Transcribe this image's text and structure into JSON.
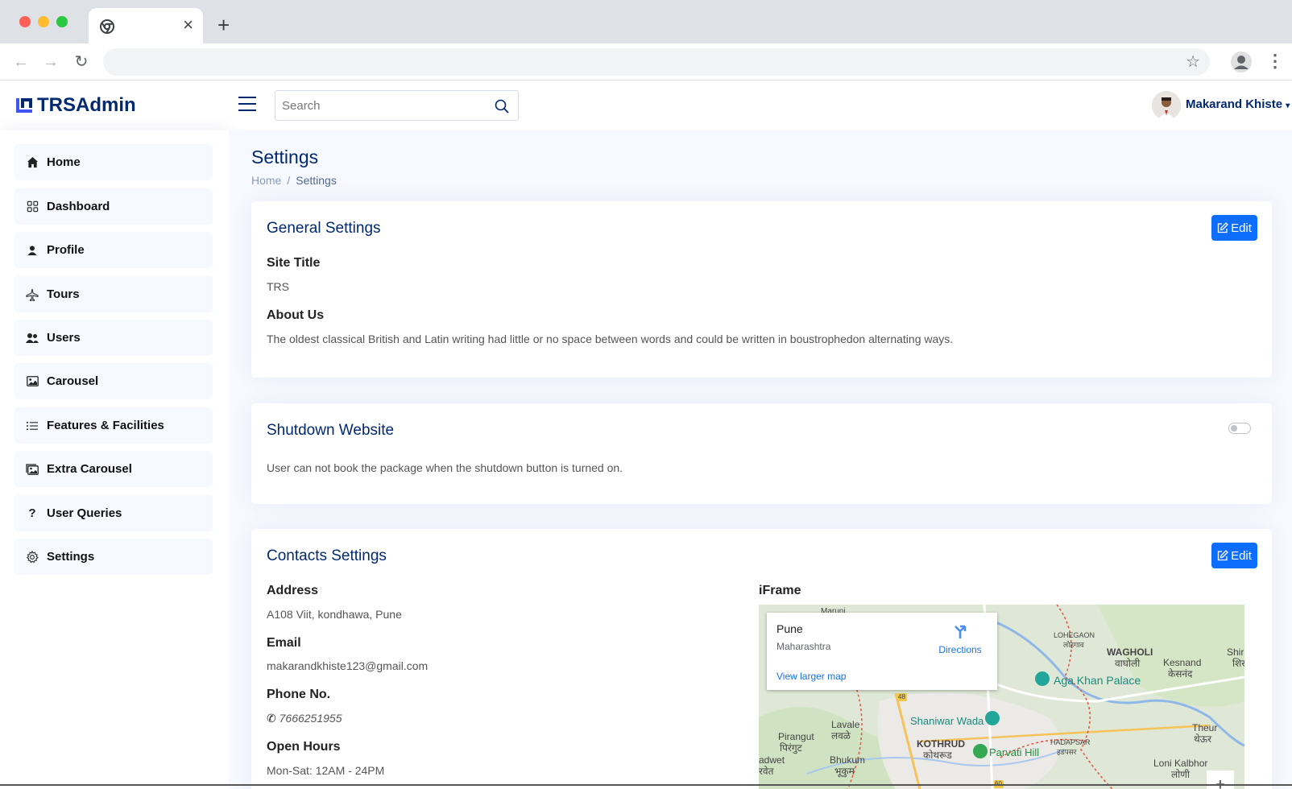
{
  "browser": {
    "colors": {
      "close": "#ff5f57",
      "minimize": "#febc2e",
      "maximize": "#28c840"
    }
  },
  "header": {
    "logo_text": "TRSAdmin",
    "search_placeholder": "Search",
    "user_name": "Makarand Khiste"
  },
  "sidebar": {
    "items": [
      {
        "label": "Home",
        "icon": "house-icon"
      },
      {
        "label": "Dashboard",
        "icon": "grid-icon"
      },
      {
        "label": "Profile",
        "icon": "person-icon"
      },
      {
        "label": "Tours",
        "icon": "airplane-icon"
      },
      {
        "label": "Users",
        "icon": "people-icon"
      },
      {
        "label": "Carousel",
        "icon": "image-icon"
      },
      {
        "label": "Features & Facilities",
        "icon": "list-icon"
      },
      {
        "label": "Extra Carousel",
        "icon": "images-icon"
      },
      {
        "label": "User Queries",
        "icon": "question-icon"
      },
      {
        "label": "Settings",
        "icon": "gear-icon"
      }
    ]
  },
  "page": {
    "title": "Settings",
    "breadcrumb": [
      "Home",
      "Settings"
    ]
  },
  "general": {
    "title": "General Settings",
    "edit_label": "Edit",
    "site_title_label": "Site Title",
    "site_title_value": "TRS",
    "about_label": "About Us",
    "about_value": "The oldest classical British and Latin writing had little or no space between words and could be written in boustrophedon alternating ways."
  },
  "shutdown": {
    "title": "Shutdown Website",
    "description": "User can not book the package when the shutdown button is turned on.",
    "enabled": false
  },
  "contacts": {
    "title": "Contacts Settings",
    "edit_label": "Edit",
    "address_label": "Address",
    "address_value": "A108 Viit, kondhawa, Pune",
    "email_label": "Email",
    "email_value": "makarandkhiste123@gmail.com",
    "phone_label": "Phone No.",
    "phone_value": "7666251955",
    "hours_label": "Open Hours",
    "hours_value": "Mon-Sat: 12AM - 24PM",
    "iframe_label": "iFrame"
  },
  "map": {
    "place_name": "Pune",
    "place_region": "Maharashtra",
    "directions_label": "Directions",
    "view_larger_label": "View larger map",
    "labels": {
      "lohegaon": "LOHEGAON",
      "lohegaon_mr": "लोहगाव",
      "wagholi": "WAGHOLI",
      "wagholi_mr": "वाघोली",
      "kesnand": "Kesnand",
      "kesnand_mr": "केसनंद",
      "shirur": "Shir",
      "shirur_mr": "शिर",
      "aga_khan": "Aga Khan Palace",
      "shaniwar": "Shaniwar Wada",
      "lavale": "Lavale",
      "lavale_mr": "लवळे",
      "pirangut": "Pirangut",
      "pirangut_mr": "पिरंगुट",
      "kothrud": "KOTHRUD",
      "kothrud_mr": "कोथरूड",
      "parvati": "Parvati Hill",
      "hadapsar": "HADAPSAR",
      "hadapsar_mr": "हडपसर",
      "theur": "Theur",
      "theur_mr": "थेऊर",
      "bhukum": "Bhukum",
      "bhukum_mr": "भूकुम",
      "adwet": "adwet",
      "adwet_mr": "रवेत",
      "loni": "Loni Kalbhor",
      "loni_mr": "लोणी",
      "route_48": "48",
      "route_60": "60",
      "maruni": "Maruni"
    }
  }
}
